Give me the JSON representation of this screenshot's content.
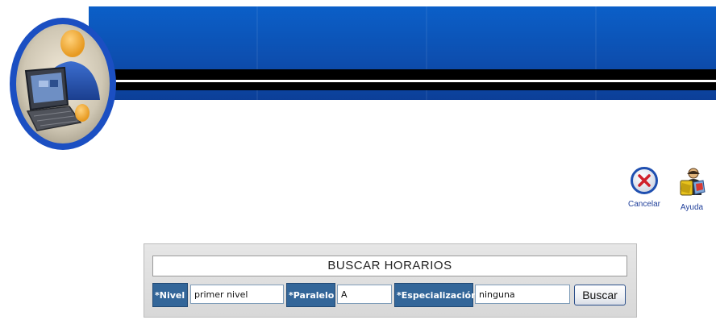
{
  "actions": {
    "cancel_label": "Cancelar",
    "help_label": "Ayuda"
  },
  "search": {
    "title": "BUSCAR HORARIOS",
    "nivel_label": "*Nivel",
    "nivel_value": "primer nivel",
    "paralelo_label": "*Paralelo",
    "paralelo_value": "A",
    "especializacion_label": "*Especialización",
    "especializacion_value": "ninguna",
    "search_button_label": "Buscar"
  },
  "colors": {
    "banner_blue": "#0d4fb0",
    "label_bg": "#336699",
    "cancel_icon": "#1f4fb0"
  },
  "icons": {
    "logo": "person-with-laptop-logo",
    "cancel": "close-circle-icon",
    "help": "help-figure-icon"
  }
}
